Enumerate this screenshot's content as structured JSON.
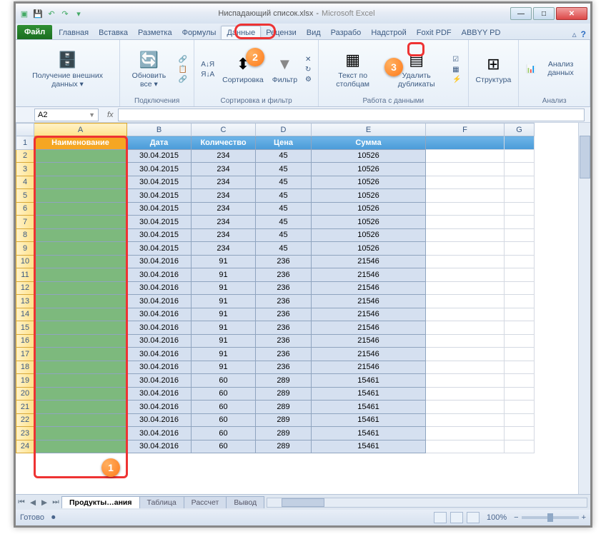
{
  "window": {
    "doc_title": "Ниспадающий список.xlsx",
    "app_title": "Microsoft Excel"
  },
  "qat": {
    "save": "💾",
    "undo": "↶",
    "redo": "↷"
  },
  "winbtns": {
    "min": "—",
    "max": "□",
    "close": "✕"
  },
  "tabs": {
    "file": "Файл",
    "home": "Главная",
    "insert": "Вставка",
    "layout": "Разметка",
    "formulas": "Формулы",
    "data": "Данные",
    "review": "Рецензи",
    "view": "Вид",
    "dev": "Разрабо",
    "addins": "Надстрой",
    "foxit": "Foxit PDF",
    "abbyy": "ABBYY PD"
  },
  "ribbon": {
    "ext_data": {
      "label": "Получение внешних данных ▾",
      "group": "Подключения"
    },
    "refresh": {
      "label": "Обновить все ▾",
      "group": "Подключения"
    },
    "conn_small": {
      "a": "Подключения",
      "b": "Свойства",
      "c": "Изменить связи"
    },
    "sort": {
      "label": "Сортировка",
      "az": "А↓Я",
      "za": "Я↓А"
    },
    "filter": {
      "label": "Фильтр",
      "small_a": "Очистить",
      "small_b": "Повторить",
      "small_c": "Дополнительно"
    },
    "sort_group": "Сортировка и фильтр",
    "text_cols": "Текст по столбцам",
    "dedup": "Удалить дубликаты",
    "data_group": "Работа с данными",
    "structure": "Структура",
    "analysis": {
      "label": "Анализ данных",
      "group": "Анализ"
    }
  },
  "namebox": "A2",
  "columns": [
    "A",
    "B",
    "C",
    "D",
    "E",
    "F",
    "G"
  ],
  "headers": {
    "A": "Наименование",
    "B": "Дата",
    "C": "Количество",
    "D": "Цена",
    "E": "Сумма"
  },
  "rows": [
    {
      "r": 2,
      "B": "30.04.2015",
      "C": "234",
      "D": "45",
      "E": "10526"
    },
    {
      "r": 3,
      "B": "30.04.2015",
      "C": "234",
      "D": "45",
      "E": "10526"
    },
    {
      "r": 4,
      "B": "30.04.2015",
      "C": "234",
      "D": "45",
      "E": "10526"
    },
    {
      "r": 5,
      "B": "30.04.2015",
      "C": "234",
      "D": "45",
      "E": "10526"
    },
    {
      "r": 6,
      "B": "30.04.2015",
      "C": "234",
      "D": "45",
      "E": "10526"
    },
    {
      "r": 7,
      "B": "30.04.2015",
      "C": "234",
      "D": "45",
      "E": "10526"
    },
    {
      "r": 8,
      "B": "30.04.2015",
      "C": "234",
      "D": "45",
      "E": "10526"
    },
    {
      "r": 9,
      "B": "30.04.2015",
      "C": "234",
      "D": "45",
      "E": "10526"
    },
    {
      "r": 10,
      "B": "30.04.2016",
      "C": "91",
      "D": "236",
      "E": "21546"
    },
    {
      "r": 11,
      "B": "30.04.2016",
      "C": "91",
      "D": "236",
      "E": "21546"
    },
    {
      "r": 12,
      "B": "30.04.2016",
      "C": "91",
      "D": "236",
      "E": "21546"
    },
    {
      "r": 13,
      "B": "30.04.2016",
      "C": "91",
      "D": "236",
      "E": "21546"
    },
    {
      "r": 14,
      "B": "30.04.2016",
      "C": "91",
      "D": "236",
      "E": "21546"
    },
    {
      "r": 15,
      "B": "30.04.2016",
      "C": "91",
      "D": "236",
      "E": "21546"
    },
    {
      "r": 16,
      "B": "30.04.2016",
      "C": "91",
      "D": "236",
      "E": "21546"
    },
    {
      "r": 17,
      "B": "30.04.2016",
      "C": "91",
      "D": "236",
      "E": "21546"
    },
    {
      "r": 18,
      "B": "30.04.2016",
      "C": "91",
      "D": "236",
      "E": "21546"
    },
    {
      "r": 19,
      "B": "30.04.2016",
      "C": "60",
      "D": "289",
      "E": "15461"
    },
    {
      "r": 20,
      "B": "30.04.2016",
      "C": "60",
      "D": "289",
      "E": "15461"
    },
    {
      "r": 21,
      "B": "30.04.2016",
      "C": "60",
      "D": "289",
      "E": "15461"
    },
    {
      "r": 22,
      "B": "30.04.2016",
      "C": "60",
      "D": "289",
      "E": "15461"
    },
    {
      "r": 23,
      "B": "30.04.2016",
      "C": "60",
      "D": "289",
      "E": "15461"
    },
    {
      "r": 24,
      "B": "30.04.2016",
      "C": "60",
      "D": "289",
      "E": "15461"
    }
  ],
  "sheets": {
    "s1": "Продукты…ания",
    "s2": "Таблица",
    "s3": "Рассчет",
    "s4": "Вывод"
  },
  "status": {
    "ready": "Готово",
    "zoom": "100%",
    "minus": "−",
    "plus": "+"
  },
  "bubbles": {
    "n1": "1",
    "n2": "2",
    "n3": "3"
  }
}
